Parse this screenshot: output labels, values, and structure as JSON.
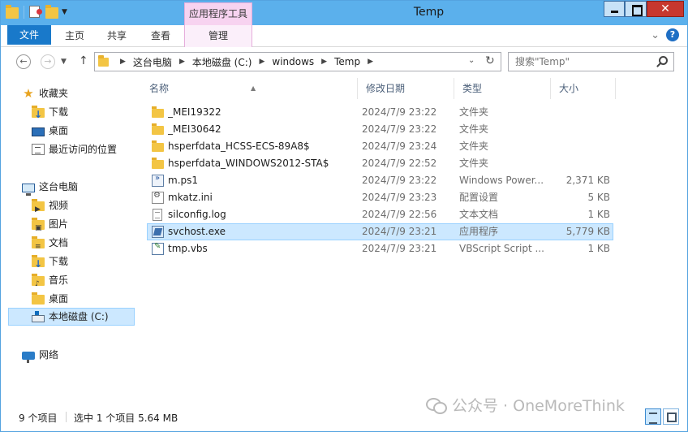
{
  "window": {
    "title": "Temp",
    "context_tab_group": "应用程序工具"
  },
  "ribbon": {
    "tabs": [
      {
        "label": "文件"
      },
      {
        "label": "主页"
      },
      {
        "label": "共享"
      },
      {
        "label": "查看"
      },
      {
        "label": "管理"
      }
    ]
  },
  "address": {
    "crumbs": [
      "这台电脑",
      "本地磁盘 (C:)",
      "windows",
      "Temp"
    ],
    "search_placeholder": "搜索\"Temp\""
  },
  "nav": {
    "favorites_label": "收藏夹",
    "favorites": [
      "下载",
      "桌面",
      "最近访问的位置"
    ],
    "this_pc_label": "这台电脑",
    "this_pc": [
      "视频",
      "图片",
      "文档",
      "下载",
      "音乐",
      "桌面",
      "本地磁盘 (C:)"
    ],
    "network_label": "网络",
    "selected": "本地磁盘 (C:)"
  },
  "columns": {
    "name": "名称",
    "date": "修改日期",
    "type": "类型",
    "size": "大小"
  },
  "files": [
    {
      "name": "_MEI19322",
      "date": "2024/7/9 23:22",
      "type": "文件夹",
      "size": "",
      "icon": "folder-icon"
    },
    {
      "name": "_MEI30642",
      "date": "2024/7/9 23:22",
      "type": "文件夹",
      "size": "",
      "icon": "folder-icon"
    },
    {
      "name": "hsperfdata_HCSS-ECS-89A8$",
      "date": "2024/7/9 23:24",
      "type": "文件夹",
      "size": "",
      "icon": "folder-icon"
    },
    {
      "name": "hsperfdata_WINDOWS2012-STA$",
      "date": "2024/7/9 22:52",
      "type": "文件夹",
      "size": "",
      "icon": "folder-icon"
    },
    {
      "name": "m.ps1",
      "date": "2024/7/9 23:22",
      "type": "Windows Power...",
      "size": "2,371 KB",
      "icon": "powershell-file-icon"
    },
    {
      "name": "mkatz.ini",
      "date": "2024/7/9 23:23",
      "type": "配置设置",
      "size": "5 KB",
      "icon": "ini-file-icon"
    },
    {
      "name": "silconfig.log",
      "date": "2024/7/9 22:56",
      "type": "文本文档",
      "size": "1 KB",
      "icon": "text-file-icon"
    },
    {
      "name": "svchost.exe",
      "date": "2024/7/9 23:21",
      "type": "应用程序",
      "size": "5,779 KB",
      "icon": "exe-file-icon",
      "selected": true
    },
    {
      "name": "tmp.vbs",
      "date": "2024/7/9 23:21",
      "type": "VBScript Script ...",
      "size": "1 KB",
      "icon": "vbs-file-icon"
    }
  ],
  "status": {
    "item_count": "9 个项目",
    "selection": "选中 1 个项目  5.64 MB",
    "watermark": "公众号 · OneMoreThink"
  },
  "colors": {
    "titlebar": "#5bb0ec",
    "file_tab": "#1979ca",
    "selection": "#cce8ff",
    "context_tab": "#f7d3f0"
  }
}
